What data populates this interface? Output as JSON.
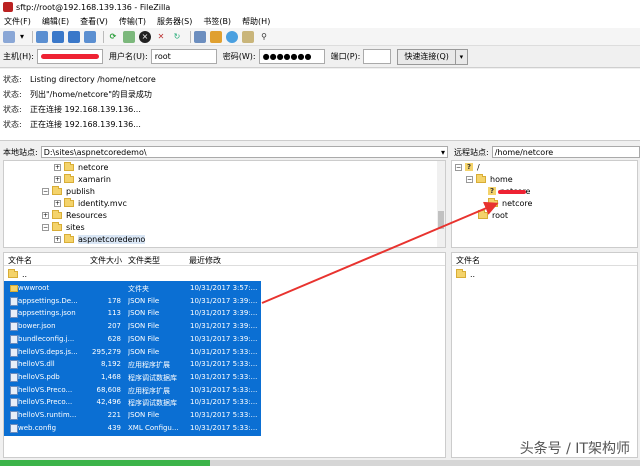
{
  "window": {
    "title": "sftp://root@192.168.139.136 - FileZilla"
  },
  "menu": [
    "文件(F)",
    "编辑(E)",
    "查看(V)",
    "传输(T)",
    "服务器(S)",
    "书签(B)",
    "帮助(H)"
  ],
  "toolbar_icons": [
    "site-manager-icon",
    "dropdown-icon",
    "toggle-log-icon",
    "toggle-local-tree-icon",
    "toggle-remote-tree-icon",
    "toggle-queue-icon",
    "refresh-icon",
    "process-queue-icon",
    "cancel-icon",
    "disconnect-icon",
    "reconnect-icon",
    "filter-icon",
    "compare-icon",
    "sync-browse-icon",
    "search-icon",
    "binoculars-icon"
  ],
  "quickconnect": {
    "host_label": "主机(H):",
    "user_label": "用户名(U):",
    "user_value": "root",
    "pass_label": "密码(W):",
    "pass_value": "●●●●●●●",
    "port_label": "端口(P):",
    "port_value": "",
    "button": "快速连接(Q)"
  },
  "log": [
    {
      "label": "状态:",
      "text": "Listing directory /home/netcore"
    },
    {
      "label": "状态:",
      "text": "列出\"/home/netcore\"的目录成功"
    },
    {
      "label": "状态:",
      "text": "正在连接 192.168.139.136..."
    },
    {
      "label": "状态:",
      "text": "正在连接 192.168.139.136..."
    }
  ],
  "local": {
    "label": "本地站点:",
    "path": "D:\\sites\\aspnetcoredemo\\",
    "tree": [
      "netcore",
      "xamarin",
      "publish",
      "identity.mvc",
      "Resources",
      "sites",
      "aspnetcoredemo"
    ],
    "columns": {
      "name": "文件名",
      "size": "文件大小",
      "type": "文件类型",
      "modified": "最近修改"
    },
    "parent": "..",
    "files": [
      {
        "name": "wwwroot",
        "size": "",
        "type": "文件夹",
        "modified": "10/31/2017 3:57:..."
      },
      {
        "name": "appsettings.De...",
        "size": "178",
        "type": "JSON File",
        "modified": "10/31/2017 3:39:..."
      },
      {
        "name": "appsettings.json",
        "size": "113",
        "type": "JSON File",
        "modified": "10/31/2017 3:39:..."
      },
      {
        "name": "bower.json",
        "size": "207",
        "type": "JSON File",
        "modified": "10/31/2017 3:39:..."
      },
      {
        "name": "bundleconfig.j...",
        "size": "628",
        "type": "JSON File",
        "modified": "10/31/2017 3:39:..."
      },
      {
        "name": "helloVS.deps.js...",
        "size": "295,279",
        "type": "JSON File",
        "modified": "10/31/2017 5:33:..."
      },
      {
        "name": "helloVS.dll",
        "size": "8,192",
        "type": "应用程序扩展",
        "modified": "10/31/2017 5:33:..."
      },
      {
        "name": "helloVS.pdb",
        "size": "1,468",
        "type": "程序调试数据库",
        "modified": "10/31/2017 5:33:..."
      },
      {
        "name": "helloVS.Preco...",
        "size": "68,608",
        "type": "应用程序扩展",
        "modified": "10/31/2017 5:33:..."
      },
      {
        "name": "helloVS.Preco...",
        "size": "42,496",
        "type": "程序调试数据库",
        "modified": "10/31/2017 5:33:..."
      },
      {
        "name": "helloVS.runtim...",
        "size": "221",
        "type": "JSON File",
        "modified": "10/31/2017 5:33:..."
      },
      {
        "name": "web.config",
        "size": "439",
        "type": "XML Configu...",
        "modified": "10/31/2017 5:33:..."
      }
    ]
  },
  "remote": {
    "label": "远程站点:",
    "path": "/home/netcore",
    "tree": [
      "/",
      "home",
      "netcore",
      "netcore",
      "root"
    ],
    "columns": {
      "name": "文件名"
    },
    "parent": ".."
  },
  "watermark": "头条号 / IT架构师",
  "colors": {
    "selection": "#0b6fd3",
    "arrow": "#e8332f",
    "progress": "#3cb44a"
  }
}
